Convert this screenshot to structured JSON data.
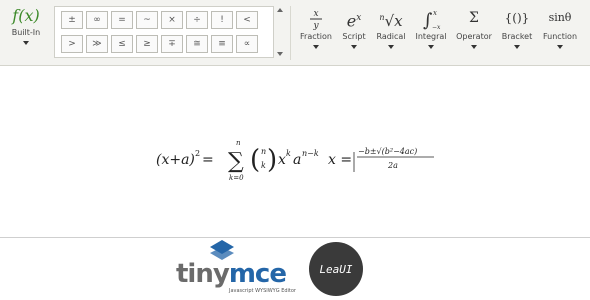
{
  "toolbar": {
    "builtin": {
      "glyph": "f(x)",
      "label": "Built-In",
      "icon": "function-icon"
    },
    "symbols": {
      "row1": [
        "±",
        "∞",
        "=",
        "~",
        "×",
        "÷",
        "!",
        "<",
        "≪"
      ],
      "row2": [
        ">",
        "≫",
        "≤",
        "≥",
        "∓",
        "≅",
        "≡",
        "∝",
        "≈"
      ]
    },
    "tools": [
      {
        "id": "fraction",
        "label": "Fraction",
        "icon": "fraction-icon"
      },
      {
        "id": "script",
        "label": "Script",
        "icon": "script-icon",
        "glyph": "e",
        "sup": "x"
      },
      {
        "id": "radical",
        "label": "Radical",
        "icon": "radical-icon",
        "glyph": "√x",
        "index": "n"
      },
      {
        "id": "integral",
        "label": "Integral",
        "icon": "integral-icon",
        "glyph": "∫",
        "upper": "x",
        "lower": "−x"
      },
      {
        "id": "operator",
        "label": "Operator",
        "icon": "operator-icon",
        "glyph": "Σ"
      },
      {
        "id": "bracket",
        "label": "Bracket",
        "icon": "bracket-icon",
        "glyph": "{()}"
      },
      {
        "id": "function",
        "label": "Function",
        "icon": "function-sin-icon",
        "glyph": "sinθ"
      }
    ],
    "fraction_glyph": {
      "num": "x",
      "den": "y"
    }
  },
  "formula": {
    "lhs_base": "(x+a)",
    "lhs_exp": "2",
    "eq": "=",
    "sum_upper": "n",
    "sum_sym": "∑",
    "sum_lower": "k=0",
    "binom_top": "n",
    "binom_bot": "k",
    "term": "x",
    "term_exp": "k",
    "term2": "a",
    "term2_exp": "n−k",
    "x_eq": "x =",
    "frac_num": "−b±√(b²−4ac)",
    "frac_den": "2a"
  },
  "footer": {
    "tinymce_a": "tiny",
    "tinymce_b": "mce",
    "tinymce_tag": "Javascript WYSIWYG Editor",
    "leaui": "LeaUI"
  },
  "colors": {
    "builtin_accent": "#3d8a2a",
    "tinymce_blue": "#2466a8",
    "tinymce_gray": "#6b6b6b",
    "leaui_bg": "#3a3a3a"
  }
}
